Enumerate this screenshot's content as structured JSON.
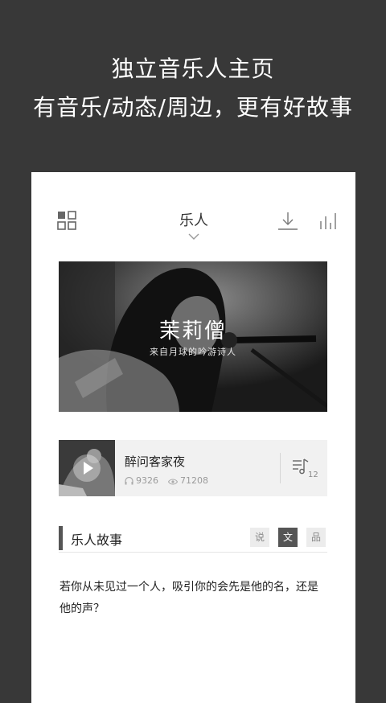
{
  "promo": {
    "line1": "独立音乐人主页",
    "line2": "有音乐/动态/周边，更有好故事"
  },
  "header": {
    "title": "乐人"
  },
  "hero": {
    "name": "茉莉僧",
    "subtitle": "来自月球的吟游诗人"
  },
  "song": {
    "title": "醉问客家夜",
    "plays": "9326",
    "views": "71208",
    "playlist_count": "12"
  },
  "story": {
    "heading": "乐人故事",
    "tabs": [
      {
        "label": "说",
        "active": false
      },
      {
        "label": "文",
        "active": true
      },
      {
        "label": "品",
        "active": false
      }
    ],
    "text": "若你从未见过一个人，吸引你的会先是他的名，还是他的声？"
  },
  "colors": {
    "background": "#383838",
    "card": "#ffffff",
    "accent": "#555555"
  }
}
